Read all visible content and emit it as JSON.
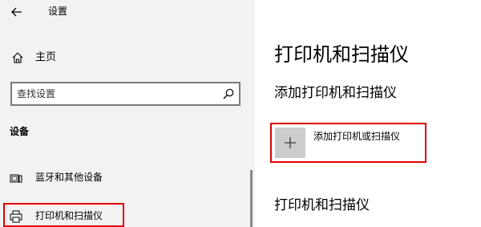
{
  "window": {
    "title": "设置"
  },
  "sidebar": {
    "home_label": "主页",
    "search_placeholder": "查找设置",
    "section_title": "设备",
    "items": [
      {
        "label": "蓝牙和其他设备",
        "icon": "bluetooth-devices-icon"
      },
      {
        "label": "打印机和扫描仪",
        "icon": "printer-icon"
      }
    ]
  },
  "main": {
    "title": "打印机和扫描仪",
    "add_section_title": "添加打印机和扫描仪",
    "add_button_label": "添加打印机或扫描仪",
    "list_section_title": "打印机和扫描仪"
  },
  "colors": {
    "highlight": "#e10000",
    "sidebar_bg": "#f2f2f2",
    "tile_bg": "#cccccc"
  }
}
